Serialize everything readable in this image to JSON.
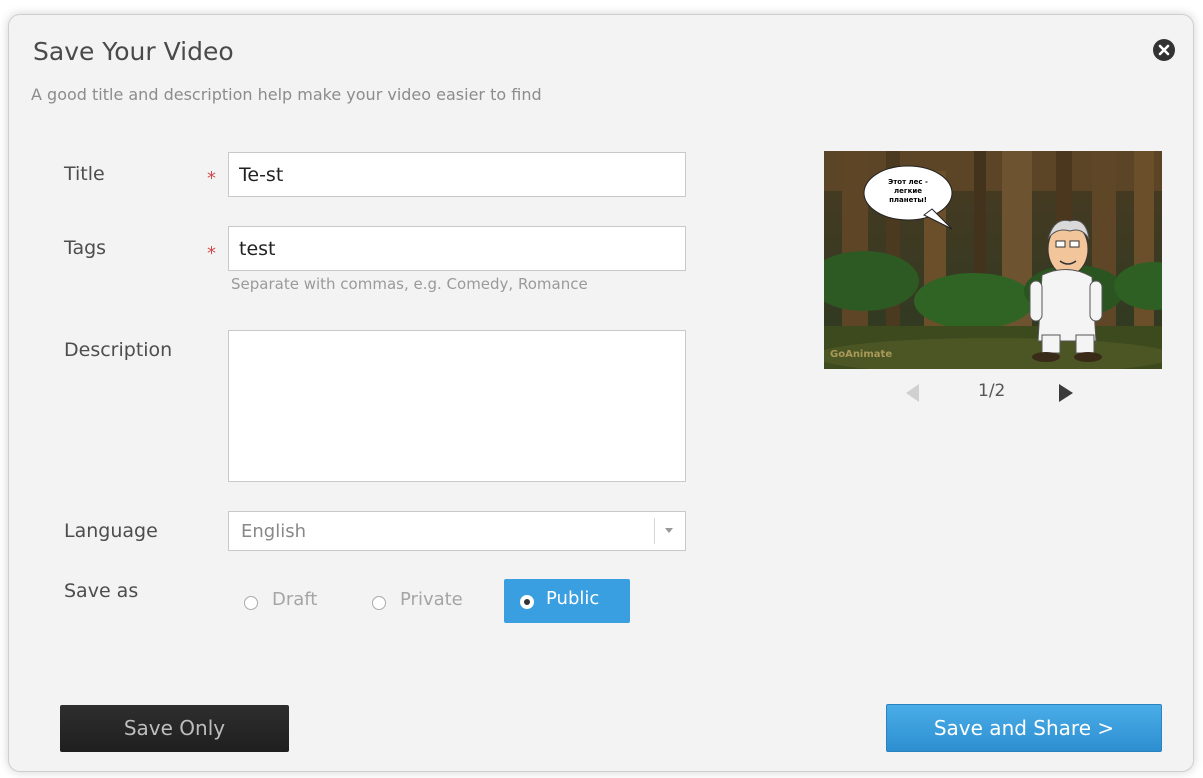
{
  "dialog": {
    "title": "Save Your Video",
    "subtitle": "A good title and description help make your video easier to find",
    "close_icon": "close-circle-icon"
  },
  "form": {
    "title_label": "Title",
    "title_value": "Te-st",
    "tags_label": "Tags",
    "tags_value": "test",
    "tags_hint": "Separate with commas, e.g. Comedy, Romance",
    "required_marker": "*",
    "description_label": "Description",
    "description_value": "",
    "language_label": "Language",
    "language_value": "English",
    "save_as_label": "Save as",
    "save_as_options": [
      {
        "label": "Draft",
        "selected": false
      },
      {
        "label": "Private",
        "selected": false
      },
      {
        "label": "Public",
        "selected": true
      }
    ]
  },
  "preview": {
    "bubble_lines": [
      "Этот лес -",
      "легкие",
      "планеты!"
    ],
    "watermark": "GoAnimate",
    "pager": "1/2",
    "prev_icon": "triangle-left-icon",
    "next_icon": "triangle-right-icon"
  },
  "buttons": {
    "save_only": "Save Only",
    "save_and_share": "Save and Share >"
  },
  "colors": {
    "accent": "#3a9fe0",
    "dark_button": "#262626",
    "dialog_bg": "#f3f3f3",
    "required": "#d24a4a"
  }
}
